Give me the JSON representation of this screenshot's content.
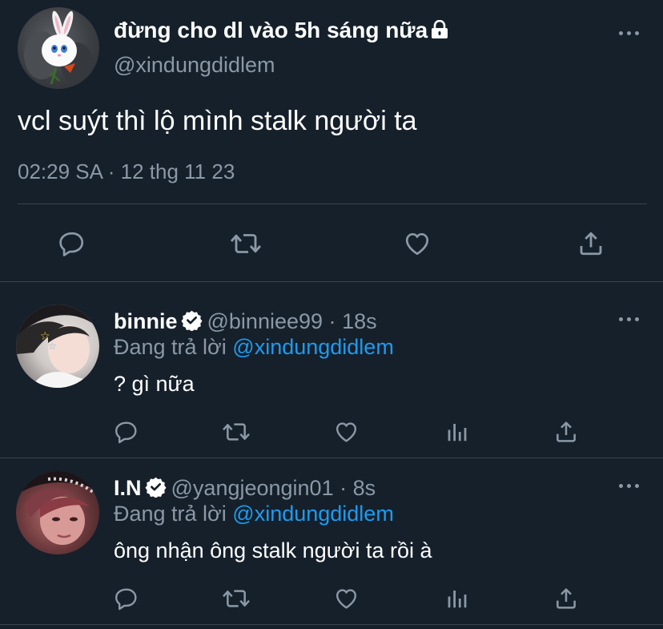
{
  "main_tweet": {
    "display_name": "đừng cho dl vào 5h sáng nữa",
    "handle": "@xindungdidlem",
    "text": "vcl suýt thì lộ mình stalk người ta",
    "timestamp": "02:29 SA · 12 thg 11 23",
    "icons": {
      "lock": "lock-icon",
      "more": "more-icon",
      "reply": "reply-icon",
      "retweet": "retweet-icon",
      "like": "heart-icon",
      "share": "share-icon"
    }
  },
  "replies": [
    {
      "display_name": "binnie",
      "handle": "@binniee99",
      "separator": "·",
      "time": "18s",
      "replying_label": "Đang trả lời",
      "replying_to": "@xindungdidlem",
      "text": "? gì nữa"
    },
    {
      "display_name": "I.N",
      "handle": "@yangjeongin01",
      "separator": "·",
      "time": "8s",
      "replying_label": "Đang trả lời",
      "replying_to": "@xindungdidlem",
      "text": "ông nhận ông stalk người ta rồi à"
    }
  ],
  "colors": {
    "background": "#15202b",
    "secondary_text": "#8b98a5",
    "link": "#1d9bf0",
    "divider": "#38444d"
  }
}
